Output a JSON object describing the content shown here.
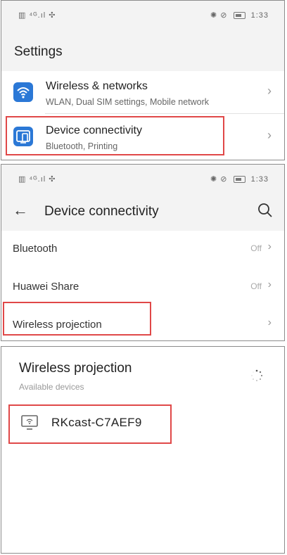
{
  "status_bar": {
    "left_icons": "▥ ⁴ᴳ.ıl ✣",
    "right_icons": "✺ ⊘",
    "time": "1:33"
  },
  "settings": {
    "title": "Settings",
    "items": [
      {
        "title": "Wireless & networks",
        "subtitle": "WLAN, Dual SIM settings, Mobile network",
        "icon": "wifi-icon"
      },
      {
        "title": "Device connectivity",
        "subtitle": "Bluetooth, Printing",
        "icon": "device-connectivity-icon"
      }
    ]
  },
  "device_connectivity": {
    "title": "Device connectivity",
    "items": [
      {
        "label": "Bluetooth",
        "value": "Off"
      },
      {
        "label": "Huawei Share",
        "value": "Off"
      },
      {
        "label": "Wireless projection",
        "value": ""
      }
    ]
  },
  "wireless_projection": {
    "title": "Wireless projection",
    "section_label": "Available devices",
    "devices": [
      {
        "name": "RKcast-C7AEF9",
        "icon": "monitor-icon"
      }
    ]
  },
  "colors": {
    "highlight": "#e04848",
    "accent_blue": "#2b78d6"
  }
}
